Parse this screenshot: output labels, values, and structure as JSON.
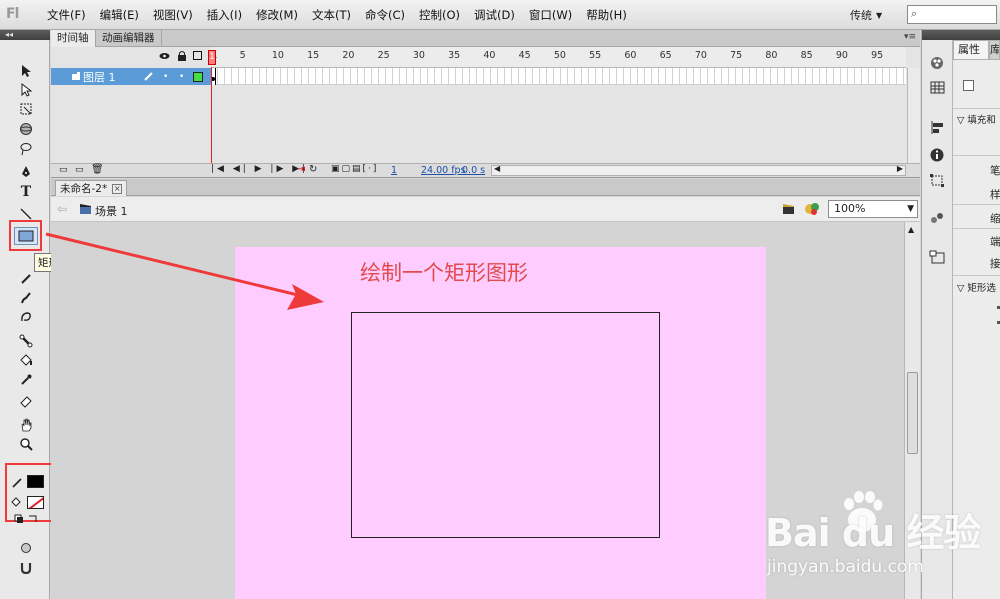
{
  "app": {
    "logo": "Fl"
  },
  "menu": [
    "文件(F)",
    "编辑(E)",
    "视图(V)",
    "插入(I)",
    "修改(M)",
    "文本(T)",
    "命令(C)",
    "控制(O)",
    "调试(D)",
    "窗口(W)",
    "帮助(H)"
  ],
  "workspace": {
    "label": "传统",
    "arrow": "▼"
  },
  "search": {
    "icon": "⌕"
  },
  "tooltip": "矩形工具(R)",
  "timeline": {
    "tabs": [
      "时间轴",
      "动画编辑器"
    ],
    "layer_name": "图层 1",
    "ruler_labels": [
      "1",
      "5",
      "10",
      "15",
      "20",
      "25",
      "30",
      "35",
      "40",
      "45",
      "50",
      "55",
      "60",
      "65",
      "70",
      "75",
      "80",
      "85",
      "90",
      "95"
    ],
    "current_frame": "1",
    "fps": "24.00 fps",
    "time": "0.0 s"
  },
  "document": {
    "tab_title": "未命名-2*",
    "scene": "场景 1",
    "zoom": "100%"
  },
  "stage": {
    "note": "绘制一个矩形图形",
    "background": "#ffccff"
  },
  "properties": {
    "tab": "属性",
    "tab2": "库",
    "section1": "填充和",
    "labels": [
      "笔",
      "样",
      "缩",
      "端",
      "接"
    ],
    "section2": "矩形选"
  },
  "colors": {
    "stroke": "#000000",
    "annotation": "#ee3a3a",
    "layer_highlight": "#5a9bd8"
  },
  "watermark": {
    "brand": "Bai du 经验",
    "url": "jingyan.baidu.com"
  }
}
